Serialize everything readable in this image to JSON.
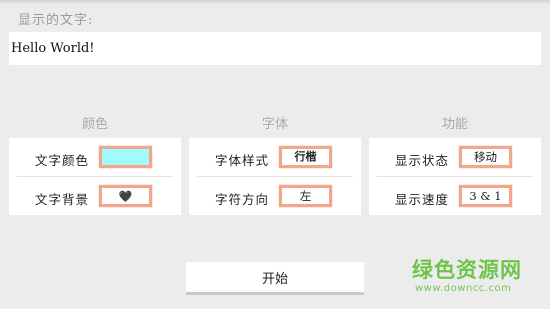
{
  "display_text": {
    "label": "显示的文字:",
    "value": "Hello World!"
  },
  "sections": [
    {
      "title": "颜色",
      "rows": [
        {
          "label": "文字颜色",
          "value": "",
          "swatch_color": "#9ffbfc"
        },
        {
          "label": "文字背景",
          "value": "🖤"
        }
      ]
    },
    {
      "title": "字体",
      "rows": [
        {
          "label": "字体样式",
          "value": "行楷"
        },
        {
          "label": "字符方向",
          "value": "左"
        }
      ]
    },
    {
      "title": "功能",
      "rows": [
        {
          "label": "显示状态",
          "value": "移动"
        },
        {
          "label": "显示速度",
          "value": "3 & 1"
        }
      ]
    }
  ],
  "start_button": {
    "label": "开始"
  },
  "watermark": {
    "text": "绿色资源网",
    "url": "www.downcc.com"
  },
  "colors": {
    "accent_border": "#f1a78c",
    "background": "#ececec",
    "watermark": "#6fc24a"
  }
}
